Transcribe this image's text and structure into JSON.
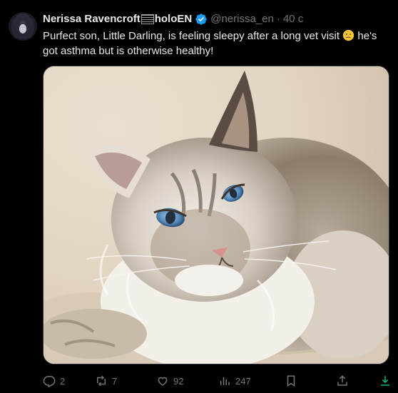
{
  "tweet": {
    "author": {
      "display_name": "Nerissa Ravencroft",
      "name_suffix": "holoEN",
      "handle": "@nerissa_en",
      "verified": true
    },
    "separator": "·",
    "time": "40 с",
    "text_before_emoji": "Purfect son, Little Darling, is feeling sleepy after a long vet visit ",
    "emoji": "😢",
    "text_after_emoji": " he's got asthma but is otherwise healthy!",
    "media": {
      "subject": "photo of a fluffy seal-point lynx ragdoll cat with blue eyes lying on a beige blanket"
    },
    "actions": {
      "replies": "2",
      "reposts": "7",
      "likes": "92",
      "views": "247"
    }
  },
  "colors": {
    "background": "#000000",
    "text": "#e7e9ea",
    "muted": "#71767b",
    "verified": "#1d9bf0",
    "download": "#00ba7c"
  }
}
